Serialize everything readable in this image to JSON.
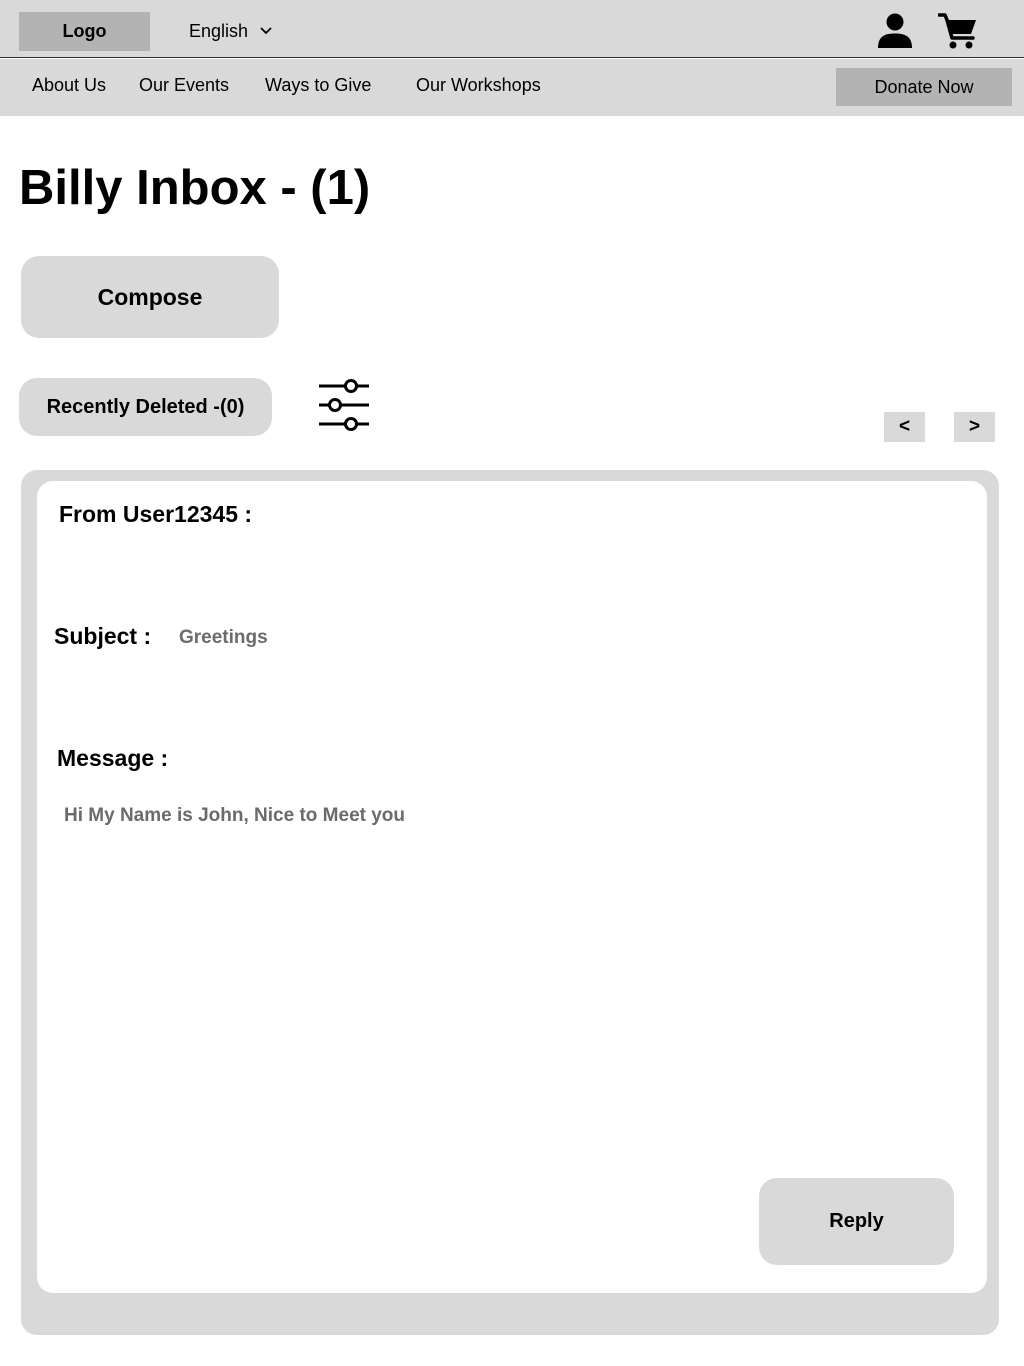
{
  "header": {
    "logo": "Logo",
    "language": "English",
    "icons": {
      "account": "account-icon",
      "cart": "shopping-cart-icon",
      "language_toggle": "chevron-down-icon"
    }
  },
  "nav": {
    "items": [
      {
        "label": "About Us"
      },
      {
        "label": "Our Events"
      },
      {
        "label": "Ways to Give"
      },
      {
        "label": "Our Workshops"
      }
    ],
    "donate_label": "Donate Now"
  },
  "inbox": {
    "title": "Billy Inbox - (1)",
    "compose_label": "Compose",
    "recently_deleted_label": "Recently Deleted -(0)",
    "filter_icon": "filter-sliders-icon",
    "prev_label": "<",
    "next_label": ">"
  },
  "message": {
    "from_label": "From User12345 :",
    "subject_label": "Subject :",
    "subject_value": "Greetings",
    "message_label": "Message :",
    "body": "Hi My Name is John, Nice to Meet you",
    "reply_label": "Reply"
  },
  "colors": {
    "bar_gray": "#d9d9d9",
    "logo_gray": "#b3b3b3",
    "muted_text": "#6b6b6b"
  }
}
